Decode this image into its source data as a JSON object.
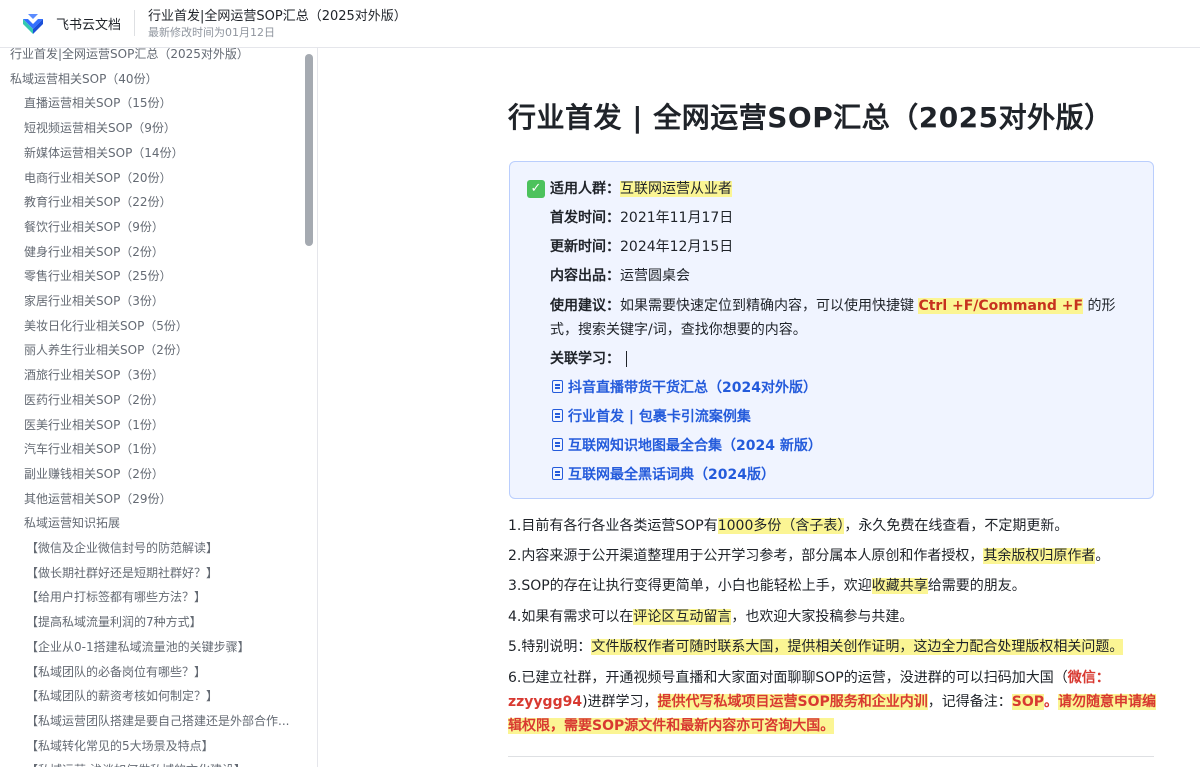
{
  "header": {
    "app_name": "飞书云文档",
    "doc_title": "行业首发|全网运营SOP汇总（2025对外版）",
    "last_modified": "最新修改时间为01月12日"
  },
  "sidebar": {
    "items": [
      {
        "label": "行业首发|全网运营SOP汇总（2025对外版）",
        "level": 1
      },
      {
        "label": "私域运营相关SOP（40份）",
        "level": 1
      },
      {
        "label": "直播运营相关SOP（15份）",
        "level": 2
      },
      {
        "label": "短视频运营相关SOP（9份）",
        "level": 2
      },
      {
        "label": "新媒体运营相关SOP（14份）",
        "level": 2
      },
      {
        "label": "电商行业相关SOP（20份）",
        "level": 2
      },
      {
        "label": "教育行业相关SOP（22份）",
        "level": 2
      },
      {
        "label": "餐饮行业相关SOP（9份）",
        "level": 2
      },
      {
        "label": "健身行业相关SOP（2份）",
        "level": 2
      },
      {
        "label": "零售行业相关SOP（25份）",
        "level": 2
      },
      {
        "label": "家居行业相关SOP（3份）",
        "level": 2
      },
      {
        "label": "美妆日化行业相关SOP（5份）",
        "level": 2
      },
      {
        "label": "丽人养生行业相关SOP（2份）",
        "level": 2
      },
      {
        "label": "酒旅行业相关SOP（3份）",
        "level": 2
      },
      {
        "label": "医药行业相关SOP（2份）",
        "level": 2
      },
      {
        "label": "医美行业相关SOP（1份）",
        "level": 2
      },
      {
        "label": "汽车行业相关SOP（1份）",
        "level": 2
      },
      {
        "label": "副业赚钱相关SOP（2份）",
        "level": 2
      },
      {
        "label": "其他运营相关SOP（29份）",
        "level": 2
      },
      {
        "label": "私域运营知识拓展",
        "level": 2
      },
      {
        "label": "【微信及企业微信封号的防范解读】",
        "level": 3
      },
      {
        "label": "【做长期社群好还是短期社群好？】",
        "level": 3
      },
      {
        "label": "【给用户打标签都有哪些方法？】",
        "level": 3
      },
      {
        "label": "【提高私域流量利润的7种方式】",
        "level": 3
      },
      {
        "label": "【企业从0-1搭建私域流量池的关键步骤】",
        "level": 3
      },
      {
        "label": "【私域团队的必备岗位有哪些？】",
        "level": 3
      },
      {
        "label": "【私域团队的薪资考核如何制定？】",
        "level": 3
      },
      {
        "label": "【私域运营团队搭建是要自己搭建还是外部合作...",
        "level": 3
      },
      {
        "label": "【私域转化常见的5大场景及特点】",
        "level": 3
      },
      {
        "label": "【私域运营:浅谈如何做私域的文化建设】",
        "level": 3
      }
    ]
  },
  "main": {
    "title": "行业首发 | 全网运营SOP汇总（2025对外版）",
    "callout": {
      "audience_label": "适用人群：",
      "audience_value": "互联网运营从业者",
      "first_release_label": "首发时间：",
      "first_release_value": "2021年11月17日",
      "update_label": "更新时间：",
      "update_value": "2024年12月15日",
      "producer_label": "内容出品：",
      "producer_value": "运营圆桌会",
      "usage_label": "使用建议：",
      "usage_text_a": "如果需要快速定位到精确内容，可以使用快捷键",
      "usage_shortcut": "Ctrl +F/Command +F",
      "usage_text_b": "的形式，搜索关键字/词，查找你想要的内容。",
      "related_label": "关联学习：",
      "related_links": [
        "抖音直播带货干货汇总（2024对外版）",
        "行业首发 | 包裹卡引流案例集",
        "互联网知识地图最全合集（2024 新版）",
        "互联网最全黑话词典（2024版）"
      ]
    },
    "notes": {
      "n1_a": "1.目前有各行各业各类运营SOP有",
      "n1_hl": "1000多份（含子表）",
      "n1_b": "，永久免费在线查看，不定期更新。",
      "n2_a": "2.内容来源于公开渠道整理用于公开学习参考，部分属本人原创和作者授权，",
      "n2_hl": "其余版权归原作者",
      "n2_b": "。",
      "n3_a": "3.SOP的存在让执行变得更简单，小白也能轻松上手，欢迎",
      "n3_hl": "收藏共享",
      "n3_b": "给需要的朋友。",
      "n4_a": "4.如果有需求可以在",
      "n4_hl": "评论区互动留言",
      "n4_b": "，也欢迎大家投稿参与共建。",
      "n5_a": "5.特别说明：",
      "n5_hl": "文件版权作者可随时联系大国，提供相关创作证明，这边全力配合处理版权相关问题。",
      "n6_a": "6.已建立社群，开通视频号直播和大家面对面聊聊SOP的运营，没进群的可以扫码加大国（",
      "n6_wechat": "微信：zzyygg94",
      "n6_b": ")进群学习，",
      "n6_hl1": "提供代写私域项目运营SOP服务和企业内训",
      "n6_c": "，记得备注：",
      "n6_hl2": "SOP",
      "n6_d": "。",
      "n6_hl3": "请勿随意申请编辑权限，需要SOP源文件和最新内容亦可咨询大国。"
    }
  }
}
